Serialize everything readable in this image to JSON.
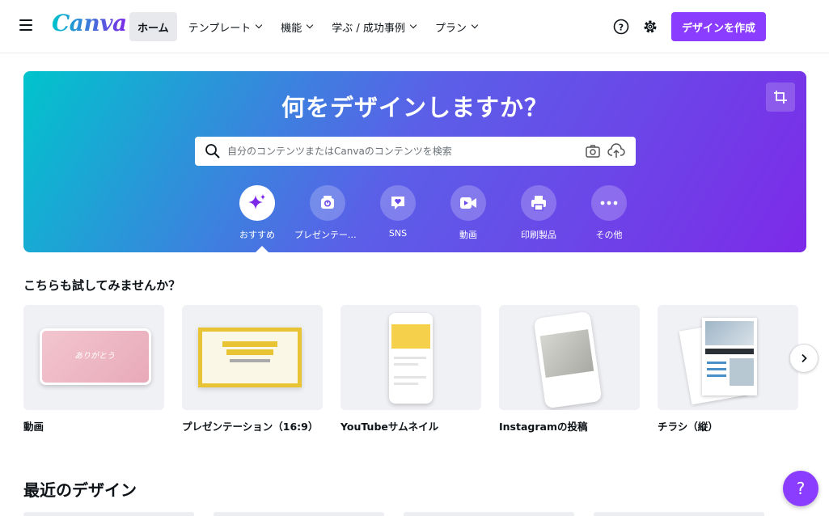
{
  "header": {
    "logo": "Canva",
    "nav": [
      {
        "label": "ホーム",
        "active": true,
        "dropdown": false
      },
      {
        "label": "テンプレート",
        "active": false,
        "dropdown": true
      },
      {
        "label": "機能",
        "active": false,
        "dropdown": true
      },
      {
        "label": "学ぶ / 成功事例",
        "active": false,
        "dropdown": true
      },
      {
        "label": "プラン",
        "active": false,
        "dropdown": true
      }
    ],
    "help_icon": "question-circle-icon",
    "settings_icon": "gear-icon",
    "create_button": "デザインを作成"
  },
  "hero": {
    "title": "何をデザインしますか？",
    "search_placeholder": "自分のコンテンツまたはCanvaのコンテンツを検索",
    "categories": [
      {
        "label": "おすすめ",
        "icon": "sparkle-icon",
        "active": true
      },
      {
        "label": "プレゼンテーション",
        "icon": "presentation-icon",
        "active": false
      },
      {
        "label": "SNS",
        "icon": "heart-chat-icon",
        "active": false
      },
      {
        "label": "動画",
        "icon": "video-camera-icon",
        "active": false
      },
      {
        "label": "印刷製品",
        "icon": "printer-icon",
        "active": false
      },
      {
        "label": "その他",
        "icon": "more-dots-icon",
        "active": false
      }
    ]
  },
  "suggestions": {
    "title": "こちらも試してみませんか？",
    "items": [
      {
        "label": "動画",
        "thumb_text": "ありがとう"
      },
      {
        "label": "プレゼンテーション（16:9）",
        "thumb_text": "マーケティング 企画書"
      },
      {
        "label": "YouTubeサムネイル",
        "thumb_text": ""
      },
      {
        "label": "Instagramの投稿",
        "thumb_text": ""
      },
      {
        "label": "チラシ（縦）",
        "thumb_text": "OPEN HOUSE"
      }
    ]
  },
  "recent": {
    "title": "最近のデザイン"
  },
  "help_fab": "?",
  "colors": {
    "brand_purple": "#8b3dff",
    "hero_start": "#00c4cc",
    "hero_end": "#7d2ae8"
  }
}
